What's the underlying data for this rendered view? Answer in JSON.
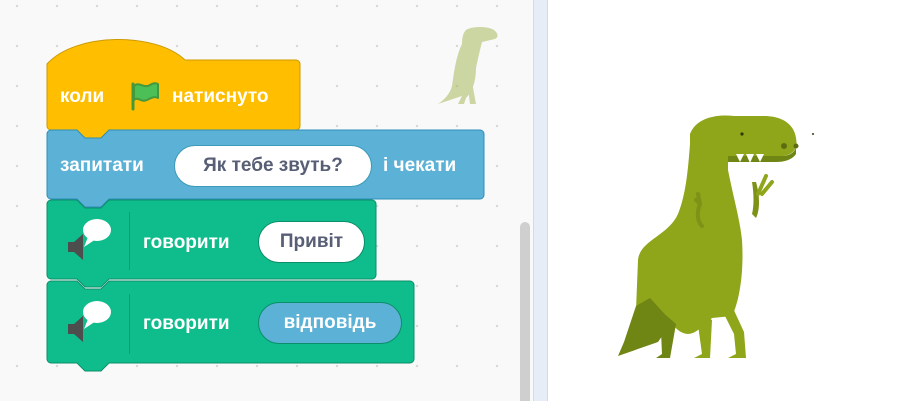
{
  "code_area": {
    "hat_block": {
      "prefix": "коли",
      "icon": "green-flag-icon",
      "suffix": "натиснуто"
    },
    "ask_block": {
      "prefix": "запитати",
      "input": "Як тебе звуть?",
      "suffix": "і чекати"
    },
    "say_block_1": {
      "icon": "text-to-speech-icon",
      "verb": "говорити",
      "input": "Привіт"
    },
    "say_block_2": {
      "icon": "text-to-speech-icon",
      "verb": "говорити",
      "reporter": "відповідь"
    },
    "sprite_thumbnail_icon": "dinosaur-sprite-icon"
  },
  "stage": {
    "sprite_icon": "dinosaur-sprite-icon"
  },
  "colors": {
    "events": "#ffbf00",
    "sensing": "#5cb1d6",
    "extension": "#0fbd8c",
    "sprite": "#8fa51a"
  }
}
